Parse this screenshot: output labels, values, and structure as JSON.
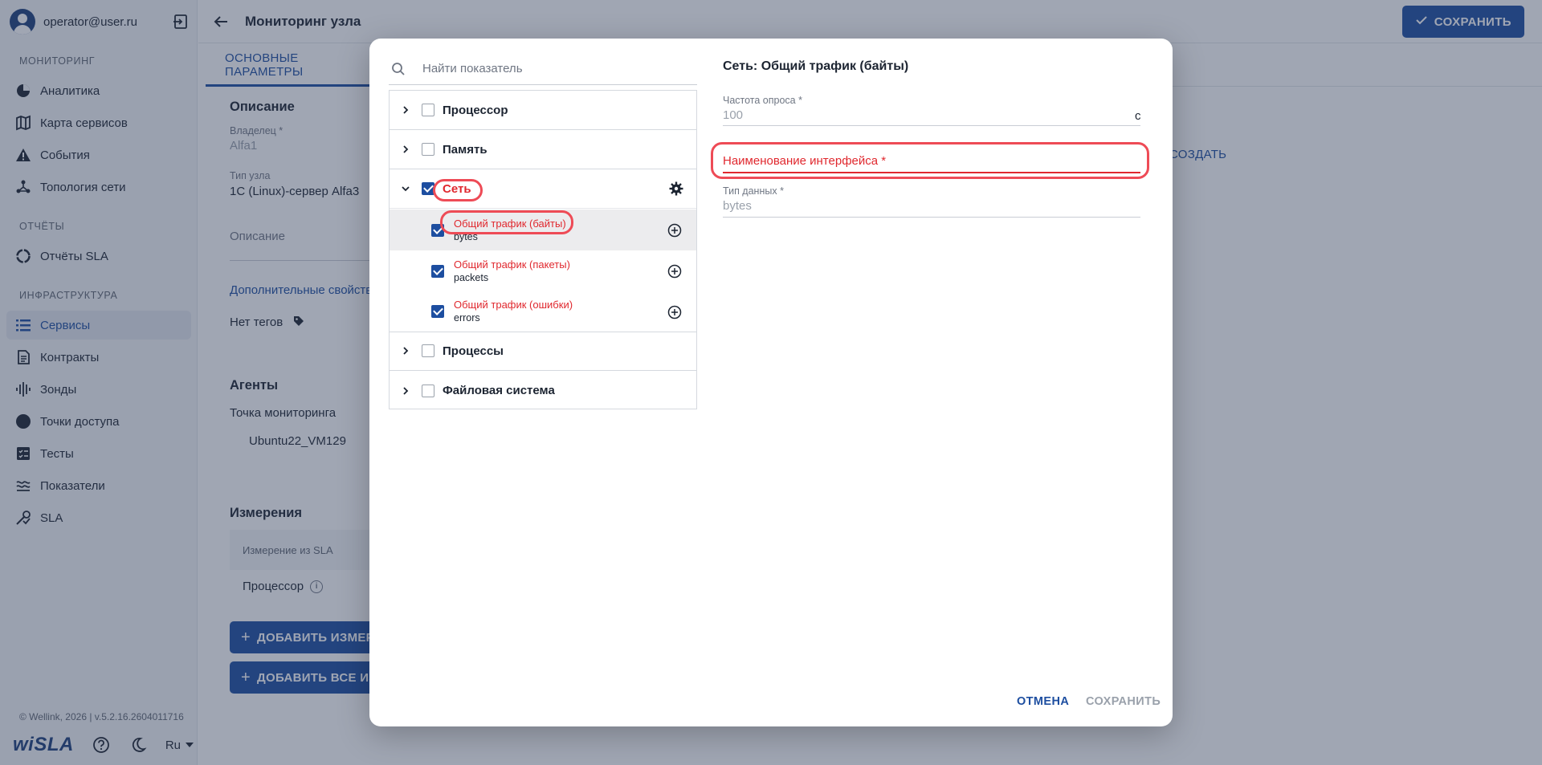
{
  "user": {
    "email": "operator@user.ru"
  },
  "sidebar": {
    "sections": [
      {
        "label": "МОНИТОРИНГ",
        "items": [
          {
            "label": "Аналитика",
            "icon": "pie-chart-icon"
          },
          {
            "label": "Карта сервисов",
            "icon": "map-icon"
          },
          {
            "label": "События",
            "icon": "warning-icon"
          },
          {
            "label": "Топология сети",
            "icon": "topology-icon"
          }
        ]
      },
      {
        "label": "ОТЧЁТЫ",
        "items": [
          {
            "label": "Отчёты SLA",
            "icon": "report-circle-icon"
          }
        ]
      },
      {
        "label": "ИНФРАСТРУКТУРА",
        "items": [
          {
            "label": "Сервисы",
            "icon": "list-icon",
            "active": true
          },
          {
            "label": "Контракты",
            "icon": "document-icon"
          },
          {
            "label": "Зонды",
            "icon": "probe-icon"
          },
          {
            "label": "Точки доступа",
            "icon": "dot-icon"
          },
          {
            "label": "Тесты",
            "icon": "test-icon"
          },
          {
            "label": "Показатели",
            "icon": "metrics-icon"
          },
          {
            "label": "SLA",
            "icon": "sla-icon"
          }
        ]
      }
    ],
    "version": "© Wellink, 2026 | v.5.2.16.2604011716",
    "logo": "wiSLA",
    "lang": "Ru"
  },
  "header": {
    "title": "Мониторинг узла",
    "save_label": "СОХРАНИТЬ"
  },
  "tabs": [
    {
      "label": "ОСНОВНЫЕ ПАРАМЕТРЫ",
      "active": true
    }
  ],
  "form": {
    "description_title": "Описание",
    "owner_label": "Владелец *",
    "owner_value": "Alfa1",
    "node_type_label": "Тип узла",
    "node_type_value": "1С (Linux)-сервер Alfa3",
    "description_placeholder": "Описание",
    "extra_props": "Дополнительные свойства",
    "no_tags": "Нет тегов",
    "agents_title": "Агенты",
    "monitoring_point_label": "Точка мониторинга",
    "monitoring_point_value": "Ubuntu22_VM129",
    "create_link": "СОЗДАТЬ",
    "measurements_title": "Измерения",
    "table_header": "Измерение из SLA",
    "row_processor": "Процессор",
    "add_measure_btn": "ДОБАВИТЬ ИЗМЕРЕНИЕ",
    "add_all_btn": "ДОБАВИТЬ ВСЕ ИЗМЕРЕНИЯ"
  },
  "dialog": {
    "search_placeholder": "Найти показатель",
    "tree": [
      {
        "label": "Процессор",
        "checked": false,
        "expanded": false
      },
      {
        "label": "Память",
        "checked": false,
        "expanded": false
      },
      {
        "label": "Сеть",
        "checked": true,
        "expanded": true,
        "children": [
          {
            "title": "Общий трафик (байты)",
            "sub": "bytes",
            "checked": true,
            "selected": true
          },
          {
            "title": "Общий трафик (пакеты)",
            "sub": "packets",
            "checked": true
          },
          {
            "title": "Общий трафик (ошибки)",
            "sub": "errors",
            "checked": true
          }
        ]
      },
      {
        "label": "Процессы",
        "checked": false,
        "expanded": false
      },
      {
        "label": "Файловая система",
        "checked": false,
        "expanded": false
      }
    ],
    "panel_title": "Сеть: Общий трафик (байты)",
    "poll_label": "Частота опроса *",
    "poll_value": "100",
    "poll_unit": "с",
    "iface_label": "Наименование интерфейса *",
    "datatype_label": "Тип данных *",
    "datatype_value": "bytes",
    "cancel_label": "ОТМЕНА",
    "save_label": "СОХРАНИТЬ"
  },
  "colors": {
    "accent": "#1d4ea0",
    "error": "#e0282e",
    "highlight": "#ee4b56",
    "overlay": "#2c3a56"
  }
}
